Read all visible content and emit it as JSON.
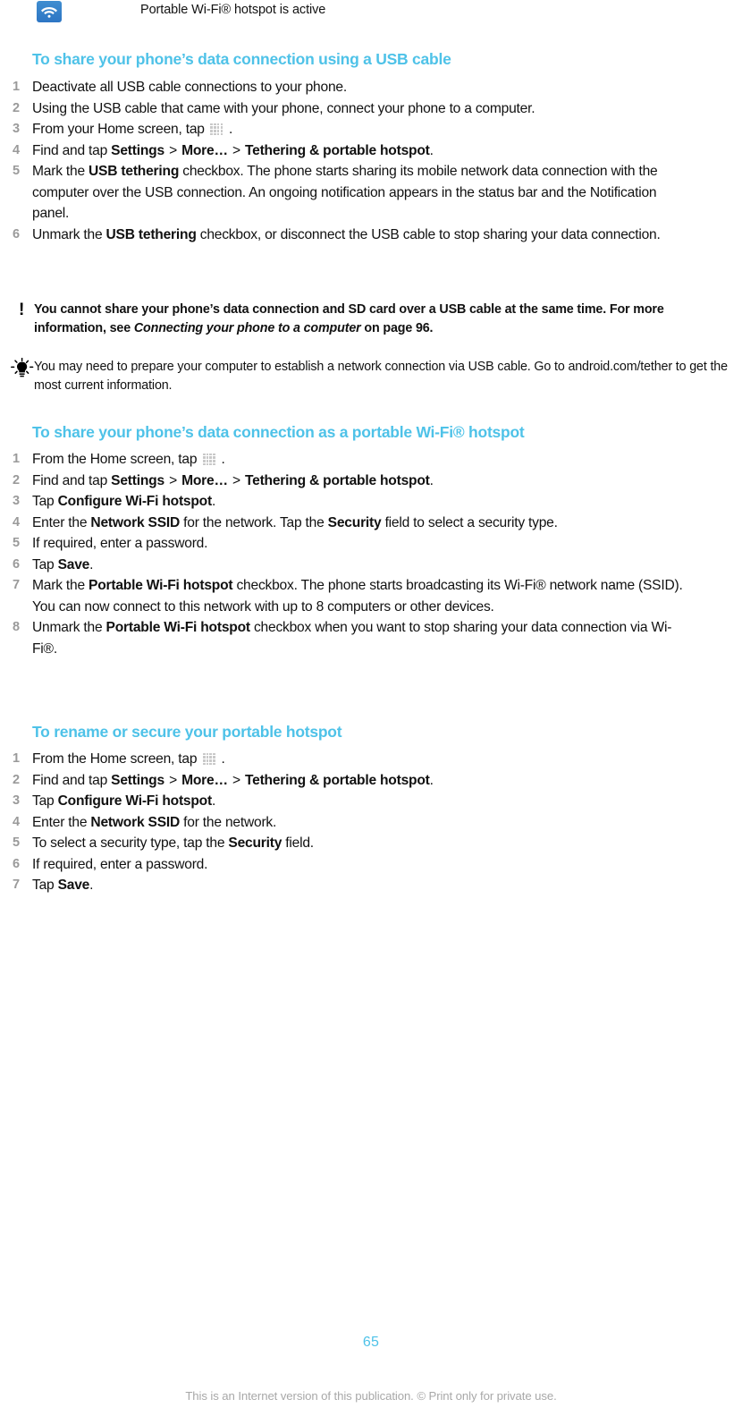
{
  "notification": {
    "icon": "wifi-icon",
    "text": "Portable Wi-Fi® hotspot is active"
  },
  "sections": [
    {
      "id": "usb",
      "heading": "To share your phone’s data connection using a USB cable",
      "steps": [
        {
          "num": "1",
          "html": "Deactivate all USB cable connections to your phone."
        },
        {
          "num": "2",
          "html": "Using the USB cable that came with your phone, connect your phone to a computer."
        },
        {
          "num": "3",
          "html": "From your Home screen, tap <span class=\"apps-icon\" data-name=\"apps-grid-icon\" data-interactable=\"true\"></span> ."
        },
        {
          "num": "4",
          "html": "Find and tap <b>Settings</b> <span class=\"gt\">&gt;</span> <b>More…</b> <span class=\"gt\">&gt;</span> <b>Tethering &amp; portable hotspot</b>."
        },
        {
          "num": "5",
          "html": "Mark the <b>USB tethering</b> checkbox. The phone starts sharing its mobile network data connection with the computer over the USB connection. An ongoing notification appears in the status bar and the Notification panel."
        },
        {
          "num": "6",
          "html": "Unmark the <b>USB tethering</b> checkbox, or disconnect the USB cable to stop sharing your data connection."
        }
      ]
    },
    {
      "id": "hotspot",
      "heading": "To share your phone’s data connection as a portable Wi-Fi® hotspot",
      "steps": [
        {
          "num": "1",
          "html": "From the Home screen, tap <span class=\"apps-icon\" data-name=\"apps-grid-icon\" data-interactable=\"true\"></span> ."
        },
        {
          "num": "2",
          "html": "Find and tap <b>Settings</b> <span class=\"gt\">&gt;</span> <b>More…</b> <span class=\"gt\">&gt;</span> <b>Tethering &amp; portable hotspot</b>."
        },
        {
          "num": "3",
          "html": "Tap <b>Configure Wi-Fi hotspot</b>."
        },
        {
          "num": "4",
          "html": "Enter the <b>Network SSID</b> for the network. Tap the <b>Security</b> field to select a security type."
        },
        {
          "num": "5",
          "html": "If required, enter a password."
        },
        {
          "num": "6",
          "html": "Tap <b>Save</b>."
        },
        {
          "num": "7",
          "html": "Mark the <b>Portable Wi-Fi hotspot</b> checkbox. The phone starts broadcasting its Wi-Fi® network name (SSID). You can now connect to this network with up to 8 computers or other devices."
        },
        {
          "num": "8",
          "html": "Unmark the <b>Portable Wi-Fi hotspot</b> checkbox when you want to stop sharing your data connection via Wi-Fi®."
        }
      ]
    },
    {
      "id": "rename",
      "heading": "To rename or secure your portable hotspot",
      "steps": [
        {
          "num": "1",
          "html": "From the Home screen, tap <span class=\"apps-icon\" data-name=\"apps-grid-icon\" data-interactable=\"true\"></span> ."
        },
        {
          "num": "2",
          "html": "Find and tap <b>Settings</b> <span class=\"gt\">&gt;</span> <b>More…</b> <span class=\"gt\">&gt;</span> <b>Tethering &amp; portable hotspot</b>."
        },
        {
          "num": "3",
          "html": "Tap <b>Configure Wi-Fi hotspot</b>."
        },
        {
          "num": "4",
          "html": "Enter the <b>Network SSID</b> for the network."
        },
        {
          "num": "5",
          "html": "To select a security type, tap the <b>Security</b> field."
        },
        {
          "num": "6",
          "html": "If required, enter a password."
        },
        {
          "num": "7",
          "html": "Tap <b>Save</b>."
        }
      ]
    }
  ],
  "callouts": {
    "warning": {
      "icon": "exclamation-icon",
      "html": "You cannot share your phone’s data connection and SD card over a USB cable at the same time. For more information, see <i>Connecting your phone to a computer</i> on page 96."
    },
    "tip": {
      "icon": "lightbulb-icon",
      "html": "You may need to prepare your computer to establish a network connection via USB cable. Go to android.com/tether to get the most current information."
    }
  },
  "footer": {
    "page_number": "65",
    "note": "This is an Internet version of this publication. © Print only for private use."
  },
  "colors": {
    "heading": "#4ec2e8",
    "page_number": "#4ec2e8",
    "step_number": "#9a9a9a",
    "footer_note": "#a8a8a8",
    "wifi_tile": "#2d76c4"
  }
}
